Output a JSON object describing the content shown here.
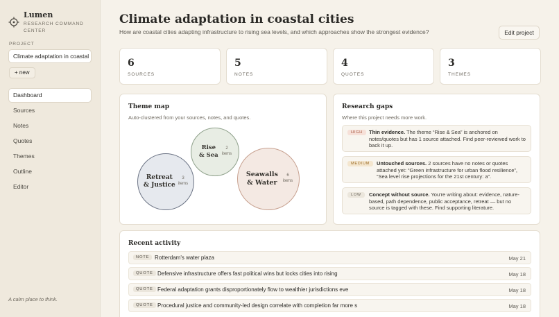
{
  "brand": {
    "name": "Lumen",
    "subtitle": "RESEARCH COMMAND CENTER"
  },
  "sidebar": {
    "project_label": "PROJECT",
    "project_value": "Climate adaptation in coastal",
    "new_label": "+ new",
    "nav": [
      {
        "label": "Dashboard",
        "active": true
      },
      {
        "label": "Sources"
      },
      {
        "label": "Notes"
      },
      {
        "label": "Quotes"
      },
      {
        "label": "Themes"
      },
      {
        "label": "Outline"
      },
      {
        "label": "Editor"
      }
    ],
    "tagline": "A calm place to think."
  },
  "header": {
    "title": "Climate adaptation in coastal cities",
    "question": "How are coastal cities adapting infrastructure to rising sea levels, and which approaches show the strongest evidence?",
    "edit_label": "Edit project"
  },
  "stats": [
    {
      "value": "6",
      "label": "SOURCES"
    },
    {
      "value": "5",
      "label": "NOTES"
    },
    {
      "value": "4",
      "label": "QUOTES"
    },
    {
      "value": "3",
      "label": "THEMES"
    }
  ],
  "theme_map": {
    "title": "Theme map",
    "subtitle": "Auto-clustered from your sources, notes, and quotes.",
    "themes": [
      {
        "name": "Rise & Sea",
        "count": "2",
        "unit": "items",
        "fill": "#e8ede4",
        "stroke": "#8ea08a"
      },
      {
        "name": "Retreat & Justice",
        "count": "3",
        "unit": "items",
        "fill": "#e6e9ee",
        "stroke": "#6b7384"
      },
      {
        "name": "Seawalls & Water",
        "count": "6",
        "unit": "items",
        "fill": "#f4e9e3",
        "stroke": "#c7a08f"
      }
    ]
  },
  "gaps": {
    "title": "Research gaps",
    "subtitle": "Where this project needs more work.",
    "items": [
      {
        "level": "HIGH",
        "heading": "Thin evidence.",
        "text": " The theme “Rise & Sea” is anchored on notes/quotes but has 1 source attached. Find peer-reviewed work to back it up.",
        "badge_bg": "#f6e0d8",
        "badge_fg": "#a5553c"
      },
      {
        "level": "MEDIUM",
        "heading": "Untouched sources.",
        "text": " 2 sources have no notes or quotes attached yet: “Green infrastructure for urban flood resilience”, “Sea level rise projections for the 21st century: a”.",
        "badge_bg": "#f4e6cf",
        "badge_fg": "#9a6b23"
      },
      {
        "level": "LOW",
        "heading": "Concept without source.",
        "text": " You're writing about: evidence, nature-based, path dependence, public acceptance, retreat — but no source is tagged with these. Find supporting literature.",
        "badge_bg": "#ebe6dc",
        "badge_fg": "#6b665c"
      }
    ]
  },
  "activity": {
    "title": "Recent activity",
    "items": [
      {
        "type": "NOTE",
        "text": "Rotterdam's water plaza",
        "date": "May 21"
      },
      {
        "type": "QUOTE",
        "text": "Defensive infrastructure offers fast political wins but locks cities into rising",
        "date": "May 18"
      },
      {
        "type": "QUOTE",
        "text": "Federal adaptation grants disproportionately flow to wealthier jurisdictions eve",
        "date": "May 18"
      },
      {
        "type": "QUOTE",
        "text": "Procedural justice and community-led design correlate with completion far more s",
        "date": "May 18"
      }
    ]
  },
  "colors": {
    "background": "#f6f2ea",
    "sidebar": "#efe9dd",
    "card": "#ffffff",
    "text": "#2b2a27"
  },
  "icons": {
    "brand": "compass-icon"
  }
}
